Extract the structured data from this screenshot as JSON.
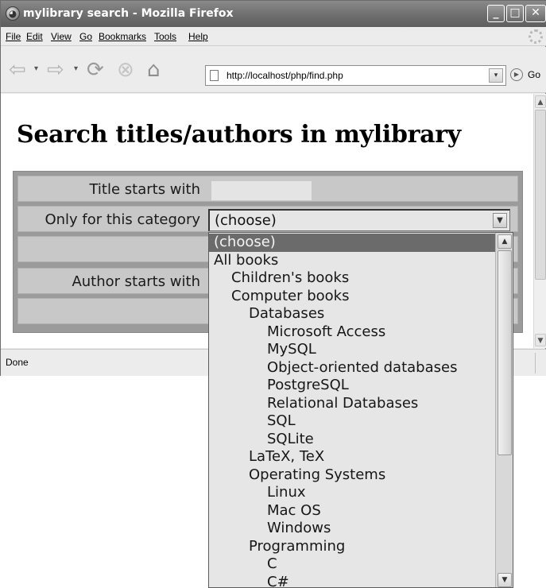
{
  "window": {
    "title": "mylibrary search - Mozilla Firefox",
    "app_icon": "firefox-icon",
    "controls": {
      "minimize": "_",
      "maximize": "□",
      "close": "✕"
    }
  },
  "menubar": {
    "items": [
      "File",
      "Edit",
      "View",
      "Go",
      "Bookmarks",
      "Tools",
      "Help"
    ]
  },
  "navigation": {
    "url": "http://localhost/php/find.php",
    "go_label": "Go"
  },
  "page": {
    "title": "Search titles/authors in mylibrary",
    "form": {
      "title_label": "Title starts with",
      "title_value": "",
      "category_label": "Only for this category",
      "category_selected": "(choose)",
      "author_label": "Author starts with",
      "author_value": ""
    }
  },
  "status": {
    "text": "Done"
  },
  "dropdown": {
    "options": [
      {
        "label": "(choose)",
        "level": 0,
        "selected": true
      },
      {
        "label": "All books",
        "level": 0
      },
      {
        "label": "Children's books",
        "level": 1
      },
      {
        "label": "Computer books",
        "level": 1
      },
      {
        "label": "Databases",
        "level": 2
      },
      {
        "label": "Microsoft Access",
        "level": 3
      },
      {
        "label": "MySQL",
        "level": 3
      },
      {
        "label": "Object-oriented databases",
        "level": 3
      },
      {
        "label": "PostgreSQL",
        "level": 3
      },
      {
        "label": "Relational Databases",
        "level": 3
      },
      {
        "label": "SQL",
        "level": 3
      },
      {
        "label": "SQLite",
        "level": 3
      },
      {
        "label": "LaTeX, TeX",
        "level": 2
      },
      {
        "label": "Operating Systems",
        "level": 2
      },
      {
        "label": "Linux",
        "level": 3
      },
      {
        "label": "Mac OS",
        "level": 3
      },
      {
        "label": "Windows",
        "level": 3
      },
      {
        "label": "Programming",
        "level": 2
      },
      {
        "label": "C",
        "level": 3
      },
      {
        "label": "C#",
        "level": 3
      }
    ]
  },
  "colors": {
    "titlebar": "#6e6e6e",
    "selected_option_bg": "#6b6b6b",
    "form_bg": "#9b9b9b",
    "row_bg": "#c8c8c8"
  }
}
